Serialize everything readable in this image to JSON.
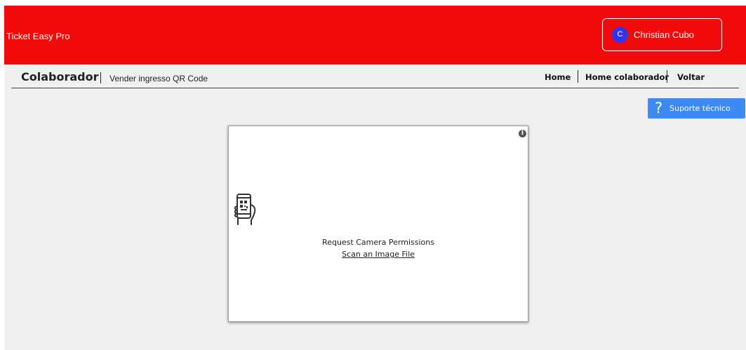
{
  "header": {
    "brand": "Ticket Easy Pro",
    "user": {
      "initial": "C",
      "name": "Christian Cubo"
    },
    "colors": {
      "header_bg": "#f20a0a",
      "avatar_bg": "#3333ee"
    }
  },
  "subheader": {
    "section": "Colaborador",
    "page_title": "Vender ingresso QR Code",
    "nav": {
      "home": "Home",
      "home_colaborador": "Home colaborador",
      "voltar": "Voltar"
    }
  },
  "support": {
    "icon": "question-mark-icon",
    "label": "Suporte técnico",
    "color": "#3d8bf2"
  },
  "scanner": {
    "info_icon": "info-icon",
    "camera_icon": "phone-qr-scan-icon",
    "request_permissions": "Request Camera Permissions",
    "scan_file": "Scan an Image File"
  }
}
